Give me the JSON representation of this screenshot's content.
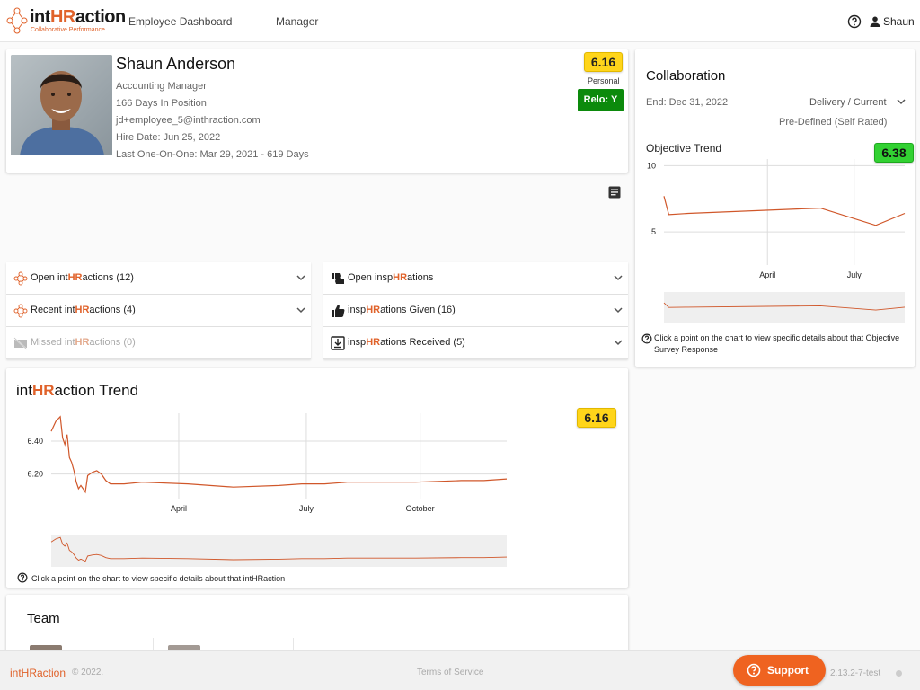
{
  "app": {
    "logo": {
      "prefix": "int",
      "hr": "HR",
      "suffix": "action",
      "tagline": "Collaborative Performance"
    },
    "nav": [
      "Employee Dashboard",
      "Manager"
    ],
    "user_name": "Shaun"
  },
  "profile": {
    "name": "Shaun Anderson",
    "lines": [
      "Accounting Manager",
      "166 Days In Position",
      "jd+employee_5@inthraction.com",
      "Hire Date: Jun 25, 2022",
      "Last One-On-One: Mar 29, 2021 - 619 Days"
    ],
    "score": "6.16",
    "score_label": "Personal",
    "relo": "Relo: Y"
  },
  "accordions": {
    "left": [
      {
        "icon": "network-icon",
        "pre": "Open int",
        "hr": "HR",
        "post": "actions (12)",
        "disabled": false
      },
      {
        "icon": "network-icon",
        "pre": "Recent int",
        "hr": "HR",
        "post": "actions (4)",
        "disabled": false
      },
      {
        "icon": "missed-icon",
        "pre": "Missed int",
        "hr": "HR",
        "post": "actions (0)",
        "disabled": true
      }
    ],
    "right": [
      {
        "icon": "thumbs-icon",
        "pre": "Open insp",
        "hr": "HR",
        "post": "ations"
      },
      {
        "icon": "thumbs-up-icon",
        "pre": "insp",
        "hr": "HR",
        "post": "ations Given (16)"
      },
      {
        "icon": "inbox-download-icon",
        "pre": "insp",
        "hr": "HR",
        "post": "ations Received (5)"
      }
    ]
  },
  "trend": {
    "title_pre": "int",
    "title_hr": "HR",
    "title_post": "action Trend",
    "score": "6.16",
    "hint": "Click a point on the chart to view specific details about that intHRaction"
  },
  "collaboration": {
    "title": "Collaboration",
    "end": "End: Dec 31, 2022",
    "selector": "Delivery / Current",
    "predefined": "Pre-Defined (Self Rated)",
    "objective_label": "Objective Trend",
    "score": "6.38",
    "hint": "Click a point on the chart to view specific details about that Objective Survey Response"
  },
  "team": {
    "title": "Team"
  },
  "footer": {
    "brand": "intHRaction",
    "copyright": "© 2022.",
    "terms": "Terms of Service",
    "support": "Support",
    "version": "2.13.2-7-test"
  },
  "colors": {
    "accent": "#e0622a",
    "line": "#d0572a",
    "yellow": "#ffd51a",
    "green": "#32d132",
    "relo": "#0c8a0c"
  },
  "chart_data": [
    {
      "type": "line",
      "title": "intHRaction Trend",
      "x_ticks": [
        "April",
        "July",
        "October"
      ],
      "y_ticks": [
        6.4,
        6.2
      ],
      "ylim": [
        6.05,
        6.57
      ],
      "xlim": [
        0,
        100
      ],
      "grid": true,
      "series": [
        {
          "x": [
            0,
            1,
            2,
            2.5,
            3,
            3.5,
            4,
            4.5,
            5,
            5.5,
            6,
            6.5,
            7,
            7.5,
            8,
            9,
            10,
            11,
            12,
            13,
            14,
            15,
            16,
            20,
            30,
            40,
            50,
            55,
            60,
            65,
            70,
            80,
            90,
            95,
            100
          ],
          "y": [
            6.46,
            6.52,
            6.55,
            6.42,
            6.38,
            6.44,
            6.3,
            6.27,
            6.22,
            6.15,
            6.11,
            6.13,
            6.11,
            6.09,
            6.19,
            6.21,
            6.22,
            6.2,
            6.16,
            6.14,
            6.14,
            6.14,
            6.14,
            6.15,
            6.14,
            6.12,
            6.13,
            6.14,
            6.14,
            6.15,
            6.15,
            6.15,
            6.16,
            6.16,
            6.17
          ]
        }
      ]
    },
    {
      "type": "line",
      "title": "Objective Trend",
      "x_ticks": [
        "April",
        "July"
      ],
      "y_ticks": [
        10,
        5
      ],
      "ylim": [
        2.5,
        10.5
      ],
      "xlim": [
        0,
        100
      ],
      "grid": true,
      "series": [
        {
          "x": [
            0,
            2,
            10,
            65,
            88,
            100
          ],
          "y": [
            7.7,
            6.3,
            6.4,
            6.8,
            5.5,
            6.4
          ]
        }
      ]
    }
  ]
}
